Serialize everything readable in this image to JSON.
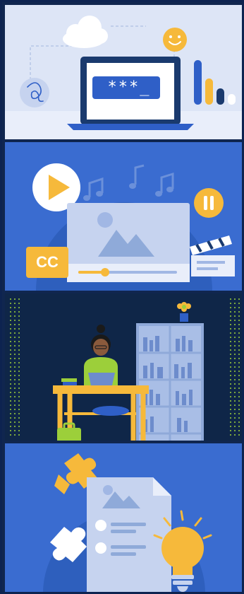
{
  "panels": {
    "sign_in": {
      "password_field": "***_"
    },
    "video": {
      "captions_badge": "CC"
    },
    "study": {},
    "ideas": {}
  },
  "colors": {
    "primary_blue": "#2f5fc7",
    "accent_yellow": "#f6b93b",
    "navy": "#0f2648",
    "light_blue": "#dde5f6"
  },
  "icons": [
    "cloud-icon",
    "smiley-icon",
    "cursive-logo-icon",
    "laptop-icon",
    "bar-chart-icon",
    "play-icon",
    "pause-icon",
    "music-note-icon",
    "clapperboard-icon",
    "image-icon",
    "puzzle-piece-icon",
    "lightbulb-icon",
    "document-icon",
    "flower-pot-icon",
    "briefcase-icon"
  ]
}
